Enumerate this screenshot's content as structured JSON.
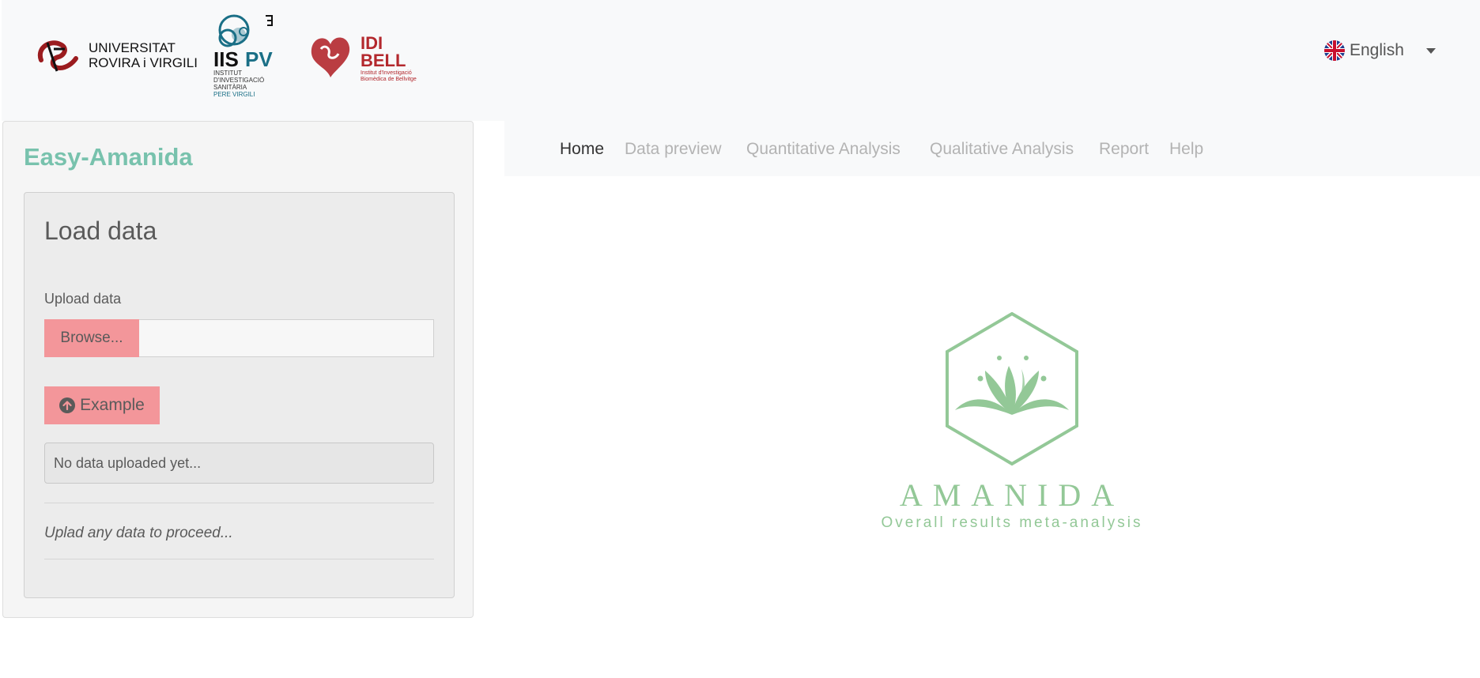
{
  "header": {
    "logos": {
      "urv": {
        "line1": "UNIVERSITAT",
        "line2": "ROVIRA i VIRGILI"
      },
      "iispv": {
        "name": "IISPV",
        "line1": "INSTITUT",
        "line2": "D'INVESTIGACIÓ",
        "line3": "SANITÀRIA",
        "line4": "PERE VIRGILI"
      },
      "idibell": {
        "line1": "IDI",
        "line2": "BELL",
        "sub1": "Institut d'Investigació",
        "sub2": "Biomèdica de Bellvitge"
      }
    },
    "language": {
      "label": "English",
      "icon": "uk-flag-icon"
    }
  },
  "sidebar": {
    "app_title": "Easy-Amanida",
    "panel": {
      "title": "Load data",
      "upload_label": "Upload data",
      "browse_label": "Browse...",
      "file_name": "",
      "example_label": "Example",
      "example_icon": "arrow-up-circle-icon",
      "status_text": "No data uploaded yet...",
      "hint": "Uplad any data to proceed..."
    }
  },
  "nav": {
    "tabs": [
      {
        "label": "Home",
        "active": true
      },
      {
        "label": "Data preview",
        "active": false
      },
      {
        "label": "Quantitative Analysis",
        "active": false
      },
      {
        "label": "Qualitative Analysis",
        "active": false
      },
      {
        "label": "Report",
        "active": false
      },
      {
        "label": "Help",
        "active": false
      }
    ]
  },
  "main": {
    "brand_name": "AMANIDA",
    "brand_subtitle": "Overall results meta-analysis"
  },
  "colors": {
    "accent": "#78c2ad",
    "button": "#f3969a",
    "brand_green": "#93c897",
    "header_bg": "#f8f9fa"
  }
}
